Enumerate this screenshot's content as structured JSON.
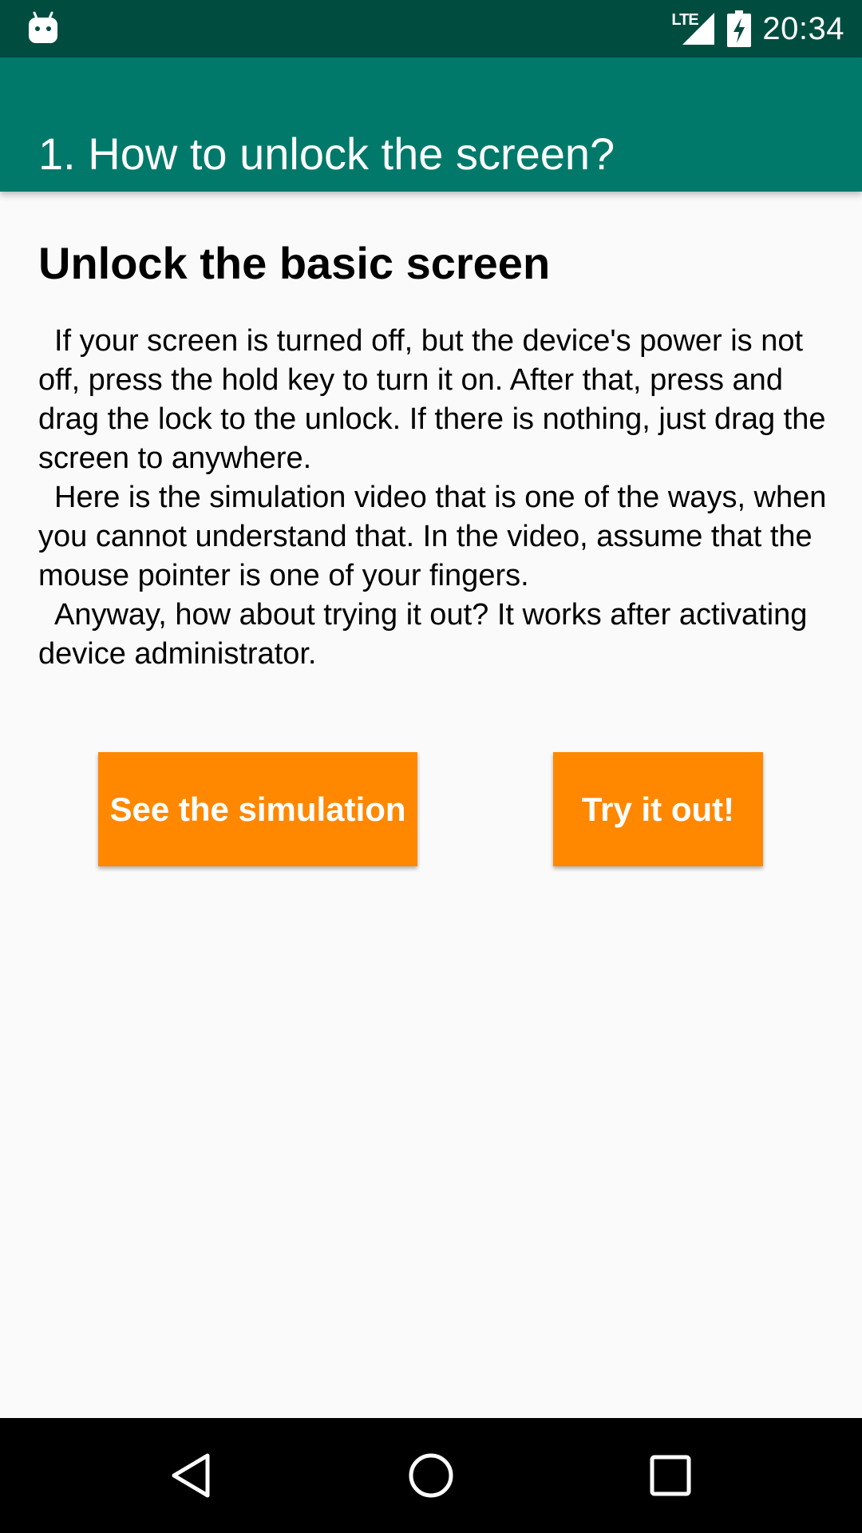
{
  "status_bar": {
    "time": "20:34",
    "network_label": "LTE",
    "left_icon": "android-notification-icon",
    "signal_icon": "cell-signal-icon",
    "battery_icon": "battery-charging-icon"
  },
  "app_bar": {
    "title": "1. How to unlock the screen?"
  },
  "content": {
    "heading": "Unlock the basic screen",
    "paragraphs": [
      "If your screen is turned off, but the device's power is not off, press the hold key to turn it on. After that, press and drag the lock to the unlock. If there is nothing, just drag the screen to anywhere.",
      "Here is the simulation video that is one of the ways, when you cannot understand that. In the video, assume that the mouse pointer is one of your fingers.",
      "Anyway, how about trying it out? It works after activating device administrator."
    ]
  },
  "buttons": {
    "simulation_label": "See the simulation",
    "try_label": "Try it out!"
  },
  "nav_bar": {
    "back_icon": "back-triangle-icon",
    "home_icon": "home-circle-icon",
    "recents_icon": "recents-square-icon"
  },
  "colors": {
    "status_bar": "#004D40",
    "app_bar": "#00796B",
    "accent_button": "#FF8800",
    "background": "#FAFAFA",
    "nav_bar": "#000000"
  }
}
